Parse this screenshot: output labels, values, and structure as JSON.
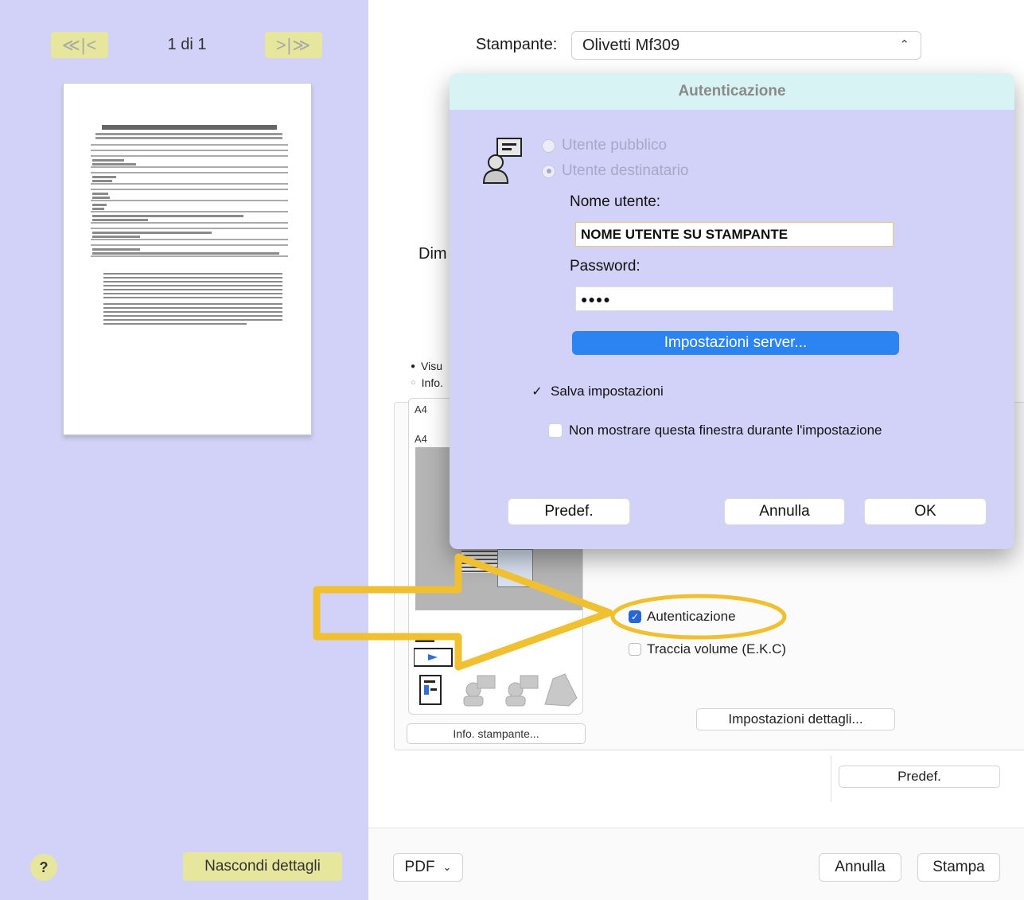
{
  "sidebar": {
    "prev_label": "≪|<",
    "next_label": ">|≫",
    "page_indicator": "1 di 1",
    "help_label": "?",
    "hide_details_label": "Nascondi dettagli"
  },
  "printer": {
    "label": "Stampante:",
    "selected": "Olivetti Mf309"
  },
  "main": {
    "clipped_dim_label": "Dim",
    "radio_visu_label": "Visu",
    "radio_info_label": "Info.",
    "paper_top": "A4",
    "paper_bottom": "A4",
    "info_printer_btn": "Info. stampante...",
    "auth_checkbox_label": "Autenticazione",
    "auth_checked": true,
    "track_volume_label": "Traccia volume (E.K.C)",
    "track_volume_checked": false,
    "details_settings_btn": "Impostazioni dettagli...",
    "default_btn": "Predef."
  },
  "bottom_bar": {
    "pdf_label": "PDF",
    "cancel_label": "Annulla",
    "print_label": "Stampa"
  },
  "dialog": {
    "title": "Autenticazione",
    "radio_public": "Utente pubblico",
    "radio_recipient": "Utente destinatario",
    "username_label": "Nome utente:",
    "username_value": "NOME UTENTE SU STAMPANTE",
    "password_label": "Password:",
    "password_value": "●●●●",
    "server_settings_btn": "Impostazioni server...",
    "save_settings_label": "Salva impostazioni",
    "save_settings_checked": true,
    "dont_show_label": "Non mostrare questa finestra durante l'impostazione",
    "dont_show_checked": false,
    "default_btn": "Predef.",
    "cancel_btn": "Annulla",
    "ok_btn": "OK"
  },
  "colors": {
    "sidebar_bg": "#d2d2f8",
    "nav_button_bg": "#e6e69d",
    "dialog_titlebar": "#d8f3f3",
    "primary_button": "#2b84f1",
    "highlight_arrow": "#f0c030",
    "checkbox_checked": "#2866d8"
  }
}
